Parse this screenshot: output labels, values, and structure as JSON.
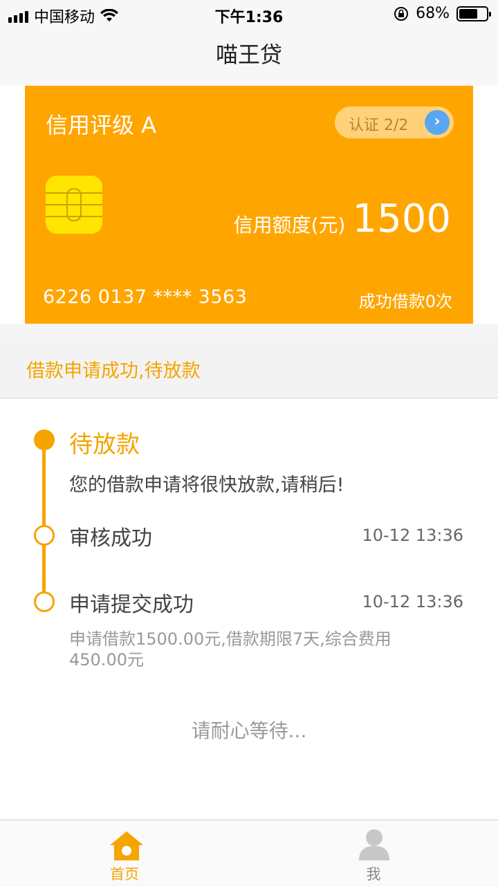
{
  "status": {
    "carrier": "中国移动",
    "time": "下午1:36",
    "battery": "68%",
    "battery_level": 0.68
  },
  "nav": {
    "title": "喵王贷"
  },
  "card": {
    "rating": "信用评级 A",
    "cert_label": "认证 2/2",
    "limit_label": "信用额度(元)",
    "limit_value": "1500",
    "number": "6226 0137 **** 3563",
    "loan_count": "成功借款0次"
  },
  "banner": {
    "text": "借款申请成功,待放款"
  },
  "timeline": [
    {
      "title": "待放款",
      "desc": "您的借款申请将很快放款,请稍后!"
    },
    {
      "title": "审核成功",
      "time": "10-12 13:36"
    },
    {
      "title": "申请提交成功",
      "time": "10-12 13:36",
      "note": "申请借款1500.00元,借款期限7天,综合费用450.00元"
    }
  ],
  "wait_text": "请耐心等待...",
  "tabs": [
    {
      "label": "首页",
      "icon": "home-icon",
      "active": true
    },
    {
      "label": "我",
      "icon": "user-icon",
      "active": false
    }
  ],
  "colors": {
    "accent": "#ffa500",
    "timeline": "#f5a400",
    "cert_badge": "#ffd27a",
    "arrow_blue": "#5aa6f2",
    "chip": "#ffe600"
  }
}
